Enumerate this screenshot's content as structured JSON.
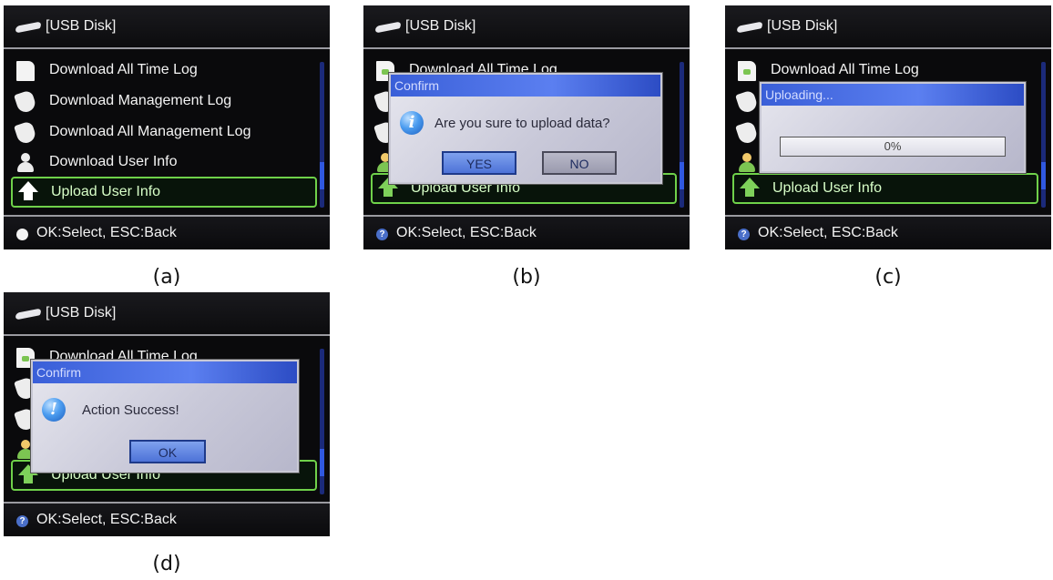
{
  "screen": {
    "title": "[USB Disk]",
    "footer": "OK:Select, ESC:Back",
    "menu": [
      {
        "label": "Download All Time Log",
        "icon": "document-icon"
      },
      {
        "label": "Download Management Log",
        "icon": "shield-icon"
      },
      {
        "label": "Download All Management Log",
        "icon": "shield-icon"
      },
      {
        "label": "Download User Info",
        "icon": "user-icon"
      },
      {
        "label": "Upload User Info",
        "icon": "upload-arrow-icon"
      }
    ],
    "colors": {
      "accent": "#6fd14a",
      "dialog_title": "#3a5fd8",
      "background": "#0a0a0c"
    }
  },
  "panels": {
    "a": {
      "caption": "(a)"
    },
    "b": {
      "caption": "(b)",
      "dialog_title": "Confirm",
      "message": "Are you sure to upload data?",
      "yes": "YES",
      "no": "NO"
    },
    "c": {
      "caption": "(c)",
      "dialog_title": "Uploading...",
      "progress_text": "0%",
      "progress": 0
    },
    "d": {
      "caption": "(d)",
      "dialog_title": "Confirm",
      "message": "Action Success!",
      "ok": "OK"
    }
  }
}
